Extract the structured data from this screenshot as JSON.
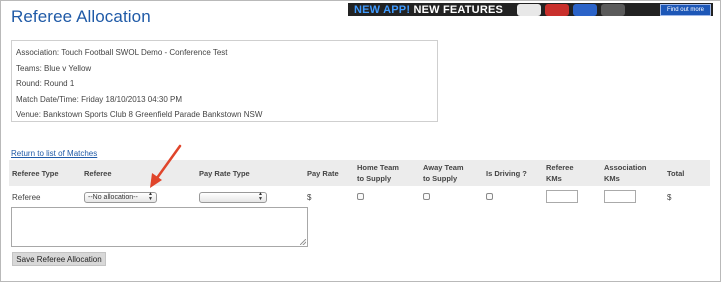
{
  "page": {
    "title": "Referee Allocation"
  },
  "banner": {
    "headline_new_app": "NEW APP!",
    "headline_features": " NEW FEATURES",
    "cta": "Find out more"
  },
  "match_info": [
    {
      "label": "Association:",
      "value": "Touch Football SWOL Demo - Conference Test"
    },
    {
      "label": "Teams:",
      "value": "Blue v Yellow"
    },
    {
      "label": "Round:",
      "value": "Round 1"
    },
    {
      "label": "Match Date/Time:",
      "value": "Friday 18/10/2013 04:30 PM"
    },
    {
      "label": "Venue:",
      "value": "Bankstown Sports Club 8 Greenfield Parade Bankstown NSW"
    }
  ],
  "return_link": "Return to list of Matches",
  "table": {
    "headers": {
      "referee_type": "Referee Type",
      "referee": "Referee",
      "pay_rate_type": "Pay Rate Type",
      "pay_rate": "Pay Rate",
      "home_team_supply_1": "Home Team",
      "home_team_supply_2": "to Supply",
      "away_team_supply_1": "Away Team",
      "away_team_supply_2": "to Supply",
      "is_driving": "Is Driving ?",
      "referee_kms_1": "Referee",
      "referee_kms_2": "KMs",
      "association_kms_1": "Association",
      "association_kms_2": "KMs",
      "total": "Total"
    },
    "row": {
      "referee_type": "Referee",
      "referee_selected": "--No allocation--",
      "pay_rate_type_selected": "",
      "pay_rate": "$",
      "total": "$"
    }
  },
  "save_button": "Save Referee Allocation",
  "colors": {
    "title": "#1f5aa7",
    "annotation_arrow": "#e0452b"
  }
}
